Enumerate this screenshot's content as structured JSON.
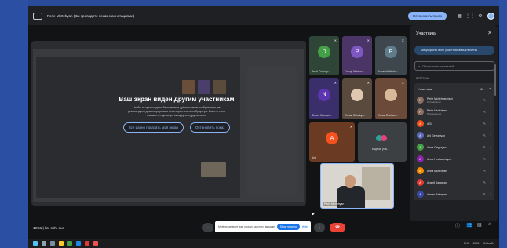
{
  "topbar": {
    "title": "Perle Mkrtchyan (Вы проводите показ с аннотациями)",
    "stop_label": "Остановить показ"
  },
  "overlay": {
    "title": "Ваш экран виден другим участникам",
    "sub1": "Чтобы на происходило бесконечное дублирование изображения, не",
    "sub2": "рекомендуем демонстрировать весь экран или окно браузера. Вместо этого",
    "sub3": "покажите отдельную вкладку или другое окно.",
    "btn_show": "Все равно показать мой экран",
    "btn_stop": "Остановить показ"
  },
  "tiles": [
    {
      "letter": "D",
      "name": "Davit Petrosy...",
      "color": "#43a047"
    },
    {
      "letter": "P",
      "name": "Paruyr Martiro...",
      "color": "#7e57c2"
    },
    {
      "letter": "E",
      "name": "Jemvelo Martir...",
      "color": "#607d8b"
    },
    {
      "letter": "N",
      "name": "Sherid Karapet...",
      "color": "#5e35b1"
    },
    {
      "letter": "",
      "name": "Gohar Sahakya...",
      "color": ""
    },
    {
      "letter": "",
      "name": "Gohar Grichan...",
      "color": ""
    },
    {
      "letter": "A",
      "name": "Ani",
      "color": "#f4511e"
    },
    {
      "letter": "",
      "name": "Ещё 46 уча...",
      "color": ""
    }
  ],
  "self_view": {
    "name": "Perle Mkrtchyan"
  },
  "panel": {
    "title": "Участники",
    "mute_all": "Микрофоны всех участников выключены",
    "search_placeholder": "Поиск пользователей",
    "section": "ВСТРЕЧА",
    "group_label": "Участники",
    "group_count": "61",
    "people": [
      {
        "initial": "P",
        "name": "Perle Mkrtchyan (вы)",
        "role": "Организатор",
        "color": "#8d6e63"
      },
      {
        "initial": "P",
        "name": "Perle Mkrtchyan",
        "role": "Презентация",
        "color": "#8d6e63"
      },
      {
        "initial": "А",
        "name": "ASI",
        "role": "",
        "color": "#f4511e"
      },
      {
        "initial": "A",
        "name": "Ani Gevorgyan",
        "role": "",
        "color": "#5c6bc0"
      },
      {
        "initial": "A",
        "name": "Anna Grigoryan",
        "role": "",
        "color": "#43a047"
      },
      {
        "initial": "A",
        "name": "Anna Hovhannisyan",
        "role": "",
        "color": "#8e24aa"
      },
      {
        "initial": "A",
        "name": "Anna Mkrtchyan",
        "role": "",
        "color": "#fb8c00"
      },
      {
        "initial": "A",
        "name": "Anahit Sargsyan",
        "role": "",
        "color": "#e53935"
      },
      {
        "initial": "A",
        "name": "Arman Babayan",
        "role": "",
        "color": "#3949ab"
      }
    ]
  },
  "clock": "10:51 | kat-sbhr-aun",
  "toast": {
    "text": "Meet предлагает вам открыть доступ к вкладке Chrome",
    "button": "Show sharing",
    "link": "Hide"
  },
  "taskbar": {
    "clock": "10:51",
    "date": "15-Nov-24",
    "lang": "ENG"
  },
  "colors": {
    "accent": "#8ab4f8",
    "hangup": "#ea4335",
    "panel": "#1f2023",
    "background": "#2a4a9a"
  }
}
